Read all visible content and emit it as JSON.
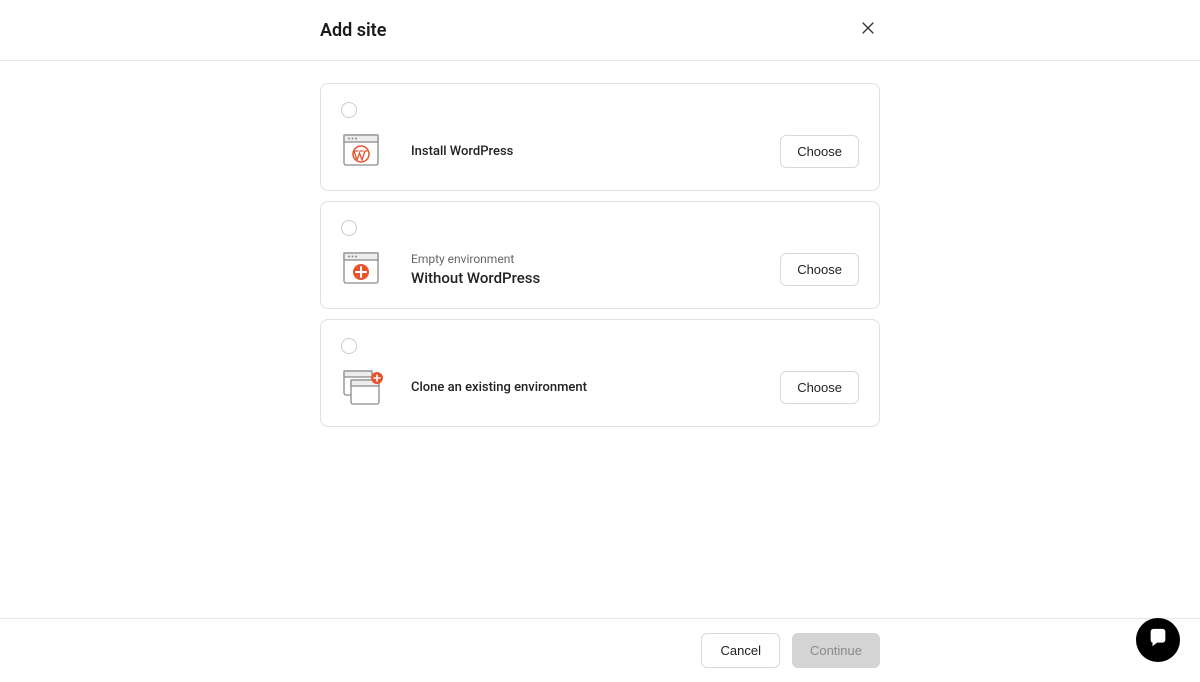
{
  "header": {
    "title": "Add site"
  },
  "options": [
    {
      "eyebrow": "",
      "title": "Install WordPress",
      "choose_label": "Choose",
      "icon": "wordpress-window-icon"
    },
    {
      "eyebrow": "Empty environment",
      "title": "Without WordPress",
      "choose_label": "Choose",
      "icon": "plus-window-icon"
    },
    {
      "eyebrow": "",
      "title": "Clone an existing environment",
      "choose_label": "Choose",
      "icon": "clone-window-icon"
    }
  ],
  "footer": {
    "cancel_label": "Cancel",
    "continue_label": "Continue"
  },
  "colors": {
    "accent": "#e8532f",
    "border": "#e0e0e0",
    "muted": "#8a8a8a"
  }
}
